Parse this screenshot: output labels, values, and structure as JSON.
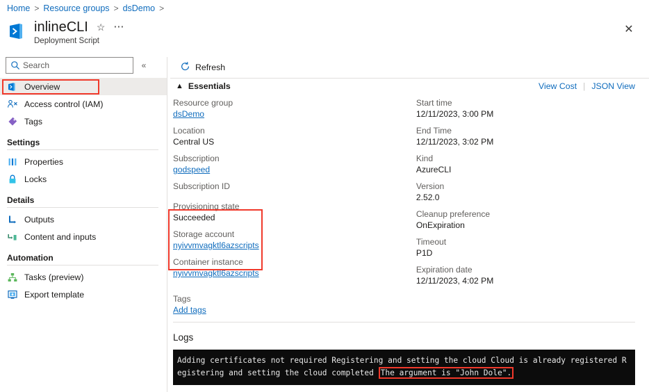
{
  "breadcrumb": {
    "items": [
      {
        "label": "Home"
      },
      {
        "label": "Resource groups"
      },
      {
        "label": "dsDemo"
      }
    ],
    "separator": ">"
  },
  "header": {
    "title": "inlineCLI",
    "subtitle": "Deployment Script",
    "resource_icon": "deployment-script-icon",
    "favorite_icon": "star-outline-icon",
    "more_icon": "ellipsis-icon",
    "close_icon": "close-icon"
  },
  "sidebar": {
    "search": {
      "placeholder": "Search",
      "value": "",
      "icon": "search-icon"
    },
    "collapse_icon": "chevron-double-left-icon",
    "items": [
      {
        "label": "Overview",
        "icon": "deployment-script-icon",
        "selected": true,
        "highlighted": true
      },
      {
        "label": "Access control (IAM)",
        "icon": "people-icon",
        "selected": false,
        "highlighted": false
      },
      {
        "label": "Tags",
        "icon": "tag-icon",
        "selected": false,
        "highlighted": false
      }
    ],
    "groups": [
      {
        "title": "Settings",
        "items": [
          {
            "label": "Properties",
            "icon": "properties-icon"
          },
          {
            "label": "Locks",
            "icon": "lock-icon"
          }
        ]
      },
      {
        "title": "Details",
        "items": [
          {
            "label": "Outputs",
            "icon": "outputs-icon"
          },
          {
            "label": "Content and inputs",
            "icon": "content-inputs-icon"
          }
        ]
      },
      {
        "title": "Automation",
        "items": [
          {
            "label": "Tasks (preview)",
            "icon": "tasks-icon"
          },
          {
            "label": "Export template",
            "icon": "export-template-icon"
          }
        ]
      }
    ]
  },
  "toolbar": {
    "refresh_label": "Refresh",
    "refresh_icon": "refresh-icon"
  },
  "essentials": {
    "label": "Essentials",
    "collapse_icon": "chevron-up-icon",
    "view_cost_label": "View Cost",
    "json_view_label": "JSON View",
    "left_fields": [
      {
        "key": "Resource group",
        "value": "dsDemo",
        "is_link": true
      },
      {
        "key": "Location",
        "value": "Central US",
        "is_link": false
      },
      {
        "key": "Subscription",
        "value": "godspeed",
        "is_link": true
      },
      {
        "key": "Subscription ID",
        "value": "",
        "is_link": false
      },
      {
        "key": "Provisioning state",
        "value": "Succeeded",
        "is_link": false
      },
      {
        "key": "Storage account",
        "value": "nyivvmvagktl6azscripts",
        "is_link": true
      },
      {
        "key": "Container instance",
        "value": "nyivvmvagktl6azscripts",
        "is_link": true
      }
    ],
    "right_fields": [
      {
        "key": "Start time",
        "value": "12/11/2023, 3:00 PM",
        "is_link": false
      },
      {
        "key": "End Time",
        "value": "12/11/2023, 3:02 PM",
        "is_link": false
      },
      {
        "key": "Kind",
        "value": "AzureCLI",
        "is_link": false
      },
      {
        "key": "Version",
        "value": "2.52.0",
        "is_link": false
      },
      {
        "key": "Cleanup preference",
        "value": "OnExpiration",
        "is_link": false
      },
      {
        "key": "Timeout",
        "value": "P1D",
        "is_link": false
      },
      {
        "key": "Expiration date",
        "value": "12/11/2023, 4:02 PM",
        "is_link": false
      }
    ],
    "tags": {
      "key": "Tags",
      "add_label": "Add tags"
    }
  },
  "logs": {
    "title": "Logs",
    "text_before": "Adding certificates not required Registering and setting the cloud Cloud is already registered Registering and setting the cloud completed ",
    "highlighted_text": "The argument is \"John Dole\"."
  },
  "colors": {
    "link": "#0f6cbd",
    "annotation_red": "#f0392b",
    "selected_row": "#edebe9",
    "console_bg": "#0c0c0c",
    "console_fg": "#e8e8e8"
  }
}
